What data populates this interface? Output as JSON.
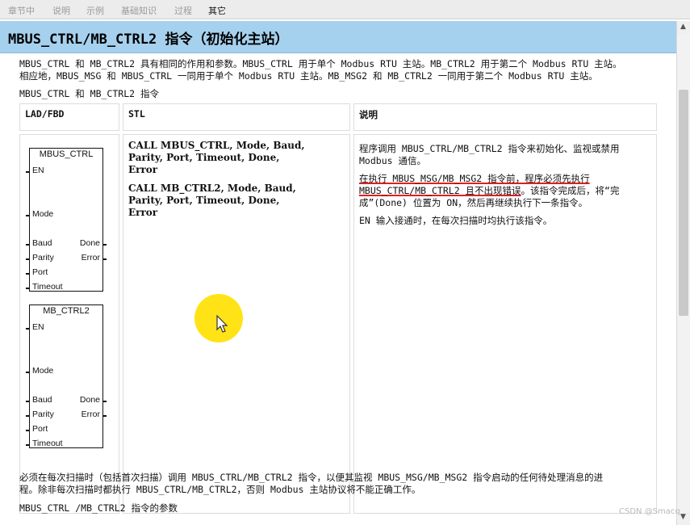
{
  "tabs": [
    {
      "label": "章节中",
      "active": false
    },
    {
      "label": "说明",
      "active": false
    },
    {
      "label": "示例",
      "active": false
    },
    {
      "label": "基础知识",
      "active": false
    },
    {
      "label": "过程",
      "active": false
    },
    {
      "label": "其它",
      "active": true
    }
  ],
  "page": {
    "title": "MBUS_CTRL/MB_CTRL2 指令（初始化主站）",
    "intro_line1": "MBUS_CTRL 和 MB_CTRL2 具有相同的作用和参数。MBUS_CTRL 用于单个 Modbus RTU 主站。MB_CTRL2 用于第二个 Modbus RTU 主站。",
    "intro_line2": "相应地，MBUS_MSG 和 MBUS_CTRL 一同用于单个 Modbus RTU 主站。MB_MSG2 和 MB_CTRL2 一同用于第二个 Modbus RTU 主站。",
    "table_caption": "MBUS_CTRL 和 MB_CTRL2 指令",
    "footer_line1": "必须在每次扫描时（包括首次扫描）调用 MBUS_CTRL/MB_CTRL2 指令，以便其监视 MBUS_MSG/MB_MSG2 指令启动的任何待处理消息的进",
    "footer_line2": "程。除非每次扫描时都执行 MBUS_CTRL/MB_CTRL2，否则 Modbus 主站协议将不能正确工作。",
    "params_heading": "MBUS_CTRL /MB_CTRL2 指令的参数"
  },
  "table": {
    "headers": {
      "lad": "LAD/FBD",
      "stl": "STL",
      "desc": "说明"
    },
    "stl": {
      "call1": [
        "CALL MBUS_CTRL, Mode, Baud,",
        "Parity, Port, Timeout, Done,",
        "Error"
      ],
      "call2": [
        "CALL MB_CTRL2, Mode, Baud,",
        "Parity, Port, Timeout, Done,",
        "Error"
      ]
    },
    "desc": {
      "p1_line1": "程序调用 MBUS_CTRL/MB_CTRL2 指令来初始化、监视或禁用",
      "p1_line2": "Modbus 通信。",
      "p2_line1": "在执行 MBUS_MSG/MB_MSG2 指令前，程序必须先执行",
      "p2_line2_u": "MBUS_CTRL/MB_CTRL2 且不出现错误",
      "p2_line2_rest": "。该指令完成后，将“完",
      "p2_line3": "成”(Done) 位置为 ON，然后再继续执行下一条指令。",
      "p3": "EN 输入接通时，在每次扫描时均执行该指令。"
    }
  },
  "blocks": [
    {
      "title": "MBUS_CTRL",
      "en": "EN",
      "mode": "Mode",
      "baud": "Baud",
      "parity": "Parity",
      "port": "Port",
      "timeout": "Timeout",
      "done": "Done",
      "error": "Error"
    },
    {
      "title": "MB_CTRL2",
      "en": "EN",
      "mode": "Mode",
      "baud": "Baud",
      "parity": "Parity",
      "port": "Port",
      "timeout": "Timeout",
      "done": "Done",
      "error": "Error"
    }
  ],
  "scroll": {
    "up": "▲",
    "down": "▼"
  },
  "watermark": "CSDN @Smacq",
  "colors": {
    "title_bar": "#a6d1ee",
    "highlight": "#ffe20a",
    "underline": "#e02020"
  }
}
